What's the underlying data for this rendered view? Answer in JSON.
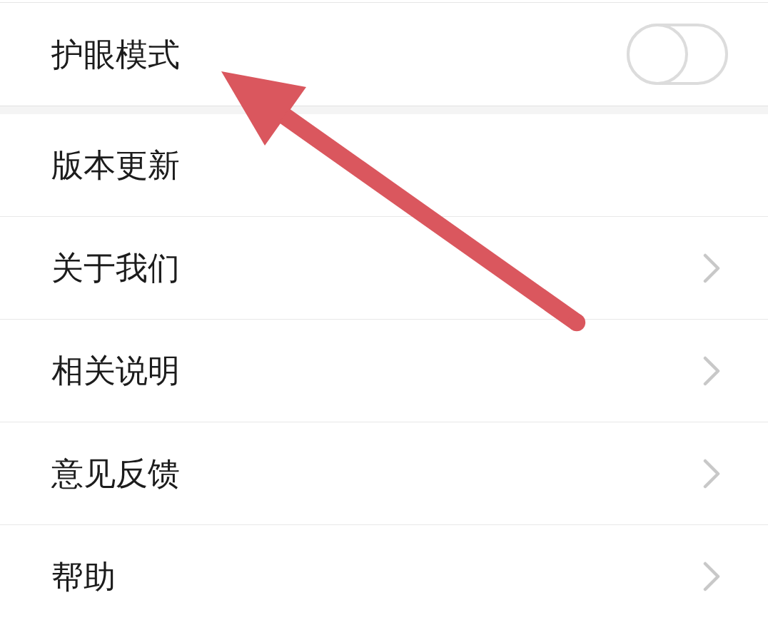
{
  "groups": [
    {
      "items": [
        {
          "kind": "toggle",
          "label": "护眼模式",
          "on": false
        }
      ]
    },
    {
      "items": [
        {
          "kind": "plain",
          "label": "版本更新"
        },
        {
          "kind": "link",
          "label": "关于我们"
        },
        {
          "kind": "link",
          "label": "相关说明"
        },
        {
          "kind": "link",
          "label": "意见反馈"
        },
        {
          "kind": "link",
          "label": "帮助"
        }
      ]
    }
  ],
  "annotation": {
    "kind": "arrow"
  }
}
